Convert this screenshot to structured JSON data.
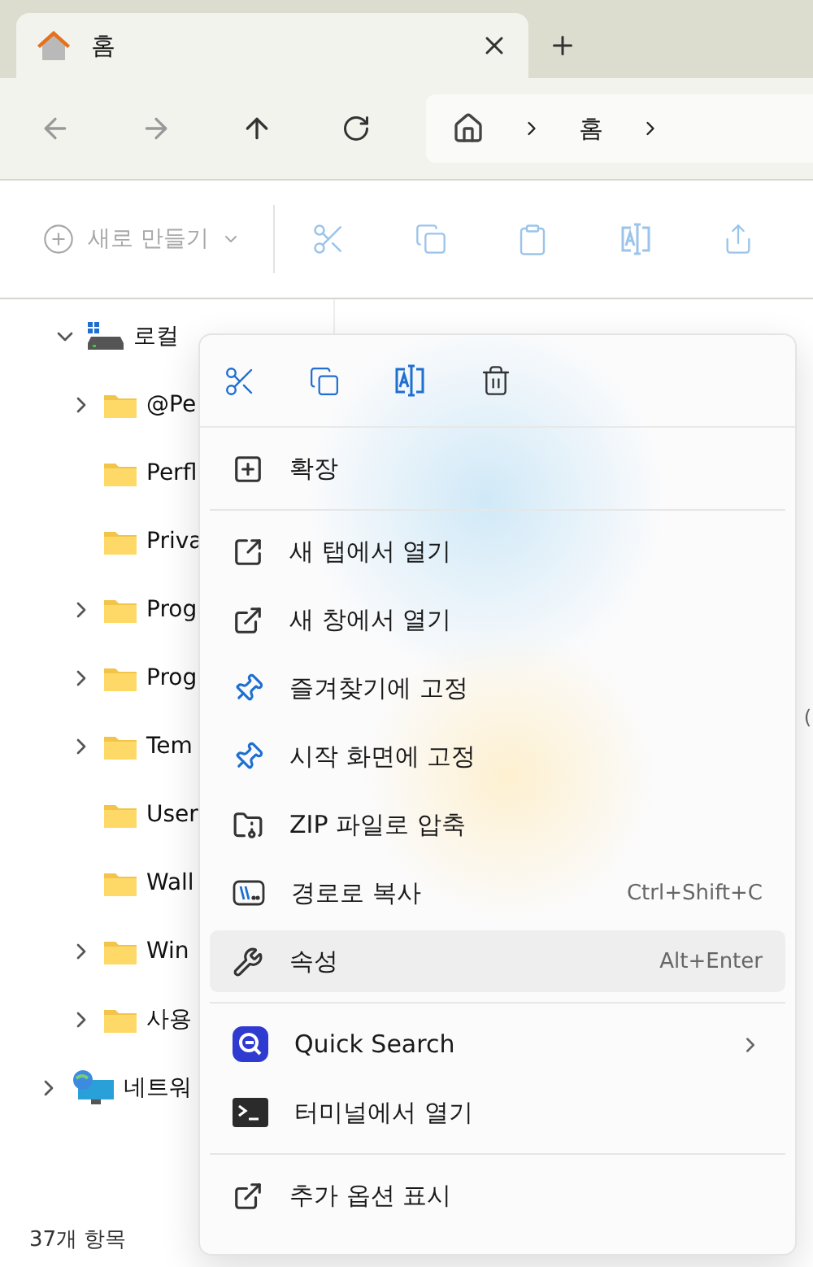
{
  "tabs": [
    {
      "title": "홈",
      "selected": true
    }
  ],
  "address": {
    "crumbs": [
      "홈"
    ]
  },
  "toolbar": {
    "new_button": {
      "label": "새로 만들기",
      "disabled": true
    }
  },
  "tree": [
    {
      "label": "로컬",
      "kind": "drive",
      "expanded": true,
      "children": [
        {
          "label": "@Pe",
          "kind": "folder",
          "expanded": false
        },
        {
          "label": "Perfl",
          "kind": "folder"
        },
        {
          "label": "Priva",
          "kind": "folder"
        },
        {
          "label": "Prog",
          "kind": "folder",
          "expanded": false
        },
        {
          "label": "Prog",
          "kind": "folder",
          "expanded": false
        },
        {
          "label": "Tem",
          "kind": "folder",
          "expanded": false
        },
        {
          "label": "User",
          "kind": "folder"
        },
        {
          "label": "Wall",
          "kind": "folder"
        },
        {
          "label": "Win",
          "kind": "folder",
          "expanded": false
        },
        {
          "label": "사용",
          "kind": "folder",
          "expanded": false
        }
      ]
    },
    {
      "label": "네트워",
      "kind": "network",
      "expanded": false
    }
  ],
  "content_fragments": [
    "("
  ],
  "context_menu": {
    "sections": [
      [
        {
          "label": "확장",
          "highlighted": false,
          "submenu": false
        }
      ],
      [
        {
          "label": "새 탭에서 열기",
          "highlighted": false,
          "submenu": false
        },
        {
          "label": "새 창에서 열기",
          "highlighted": false,
          "submenu": false
        },
        {
          "label": "즐겨찾기에 고정",
          "highlighted": false,
          "submenu": false
        },
        {
          "label": "시작 화면에 고정",
          "highlighted": false,
          "submenu": false
        },
        {
          "label": "ZIP 파일로 압축",
          "highlighted": false,
          "submenu": false
        },
        {
          "label": "경로로 복사",
          "shortcut": "Ctrl+Shift+C",
          "highlighted": false,
          "submenu": false
        },
        {
          "label": "속성",
          "shortcut": "Alt+Enter",
          "highlighted": true,
          "submenu": false
        }
      ],
      [
        {
          "label": "Quick Search",
          "highlighted": false,
          "submenu": true
        },
        {
          "label": "터미널에서 열기",
          "highlighted": false,
          "submenu": false
        }
      ],
      [
        {
          "label": "추가 옵션 표시",
          "highlighted": false,
          "submenu": false
        }
      ]
    ]
  },
  "status_bar": {
    "count": "37개 항목"
  }
}
